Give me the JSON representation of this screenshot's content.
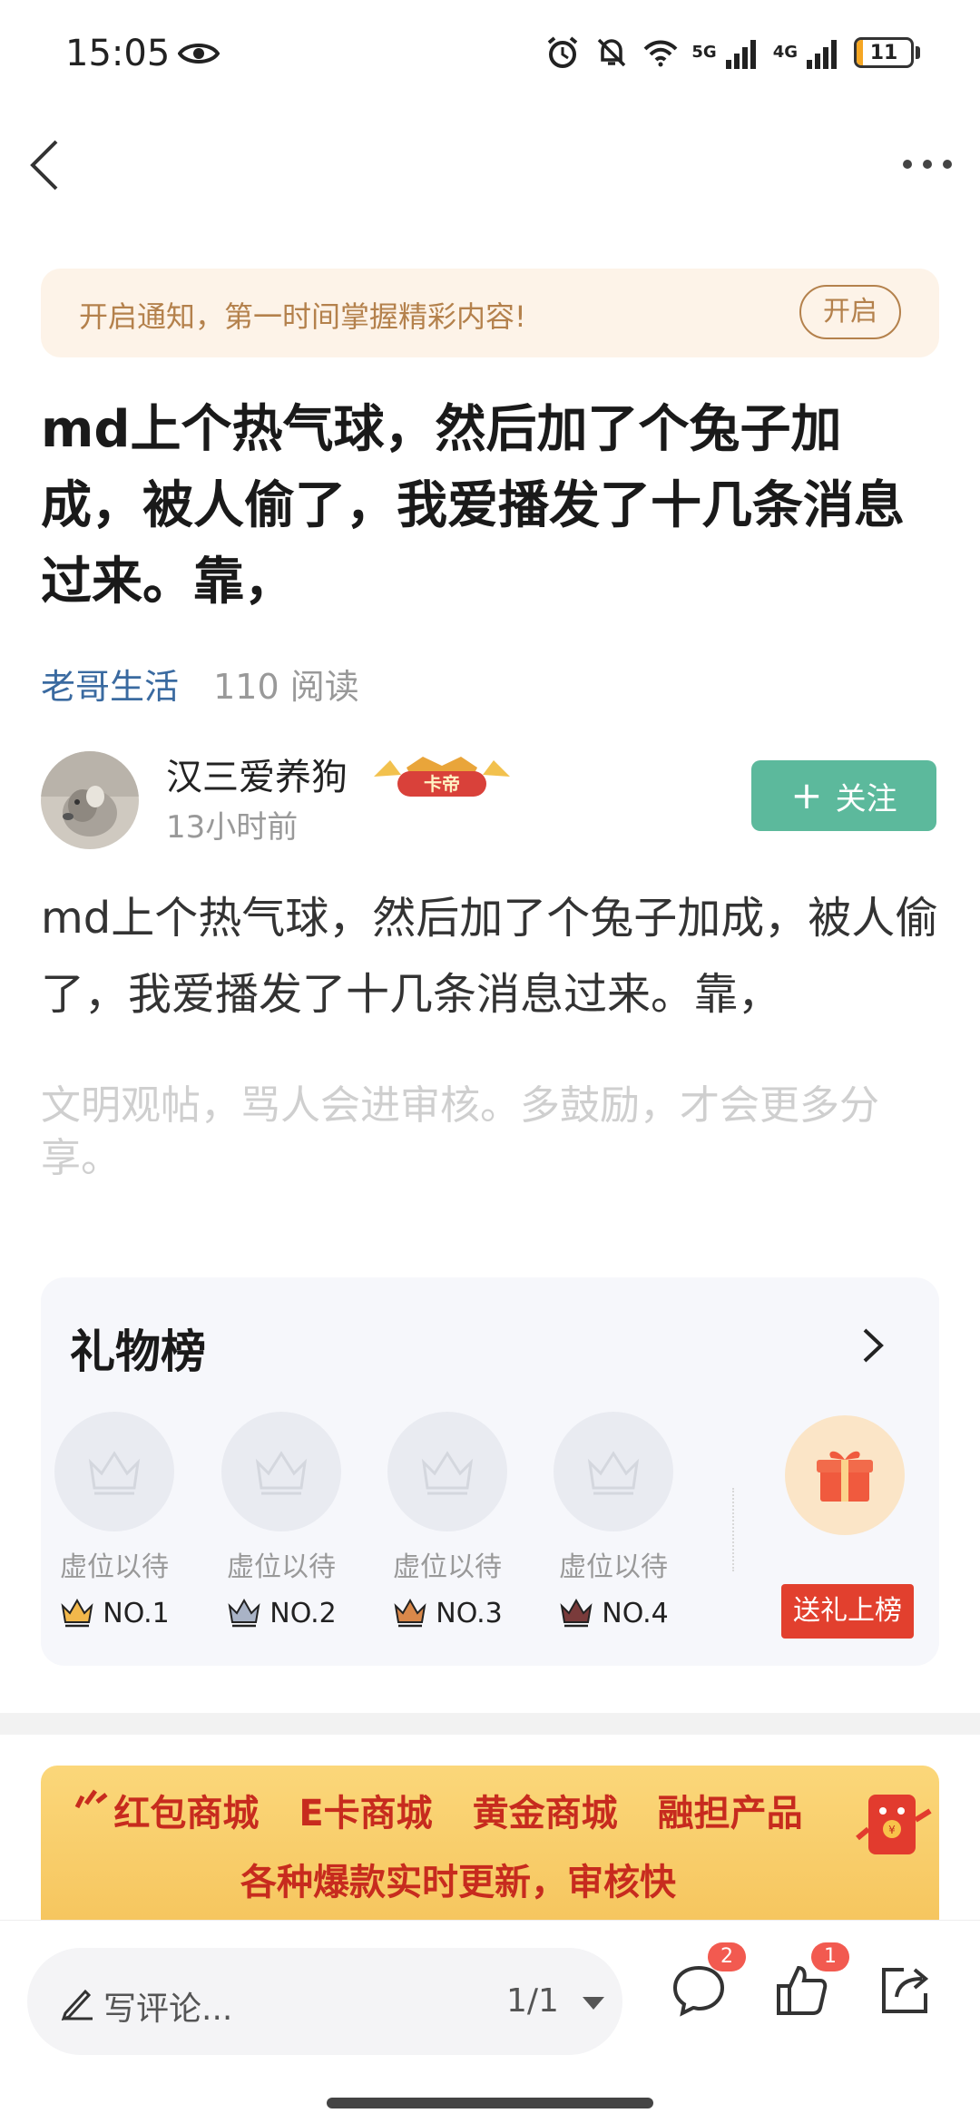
{
  "status_bar": {
    "time": "15:05",
    "net_5g": "5G",
    "net_4g": "4G",
    "battery_level": "11",
    "battery_fraction": 0.11,
    "icons": [
      "eye-icon",
      "alarm-icon",
      "mute-icon",
      "wifi-icon",
      "signal-icon",
      "battery-icon"
    ]
  },
  "nav": {
    "back_icon": "chevron-left",
    "more_icon": "more-dots"
  },
  "notify": {
    "text": "开启通知，第一时间掌握精彩内容!",
    "button": "开启"
  },
  "post": {
    "title": "md上个热气球，然后加了个兔子加成，被人偷了，我爱播发了十几条消息过来。靠，",
    "category": "老哥生活",
    "reads": "110 阅读",
    "body": "md上个热气球，然后加了个兔子加成，被人偷了，我爱播发了十几条消息过来。靠，",
    "hint": "文明观帖，骂人会进审核。多鼓励，才会更多分享。"
  },
  "author": {
    "name": "汉三爱养狗",
    "badge_text": "卡帝",
    "time": "13小时前",
    "follow_plus": "+",
    "follow_label": "关注"
  },
  "gift_ranking": {
    "title": "礼物榜",
    "slots": [
      {
        "label": "虚位以待",
        "rank": "NO.1",
        "color": "#f2b84b"
      },
      {
        "label": "虚位以待",
        "rank": "NO.2",
        "color": "#a9b3c6"
      },
      {
        "label": "虚位以待",
        "rank": "NO.3",
        "color": "#d9884a"
      },
      {
        "label": "虚位以待",
        "rank": "NO.4",
        "color": "#7a3b3b"
      }
    ],
    "send_button": "送礼上榜"
  },
  "banner": {
    "items": [
      "红包商城",
      "E卡商城",
      "黄金商城",
      "融担产品"
    ],
    "subtitle": "各种爆款实时更新，审核快"
  },
  "bottom_bar": {
    "comment_placeholder": "写评论...",
    "page": "1/1",
    "comment_count": "2",
    "like_count": "1"
  },
  "colors": {
    "accent_green": "#5cb99c",
    "link_blue": "#3a6aa0",
    "notify_gold": "#b4814c",
    "gift_red": "#e2402e"
  }
}
